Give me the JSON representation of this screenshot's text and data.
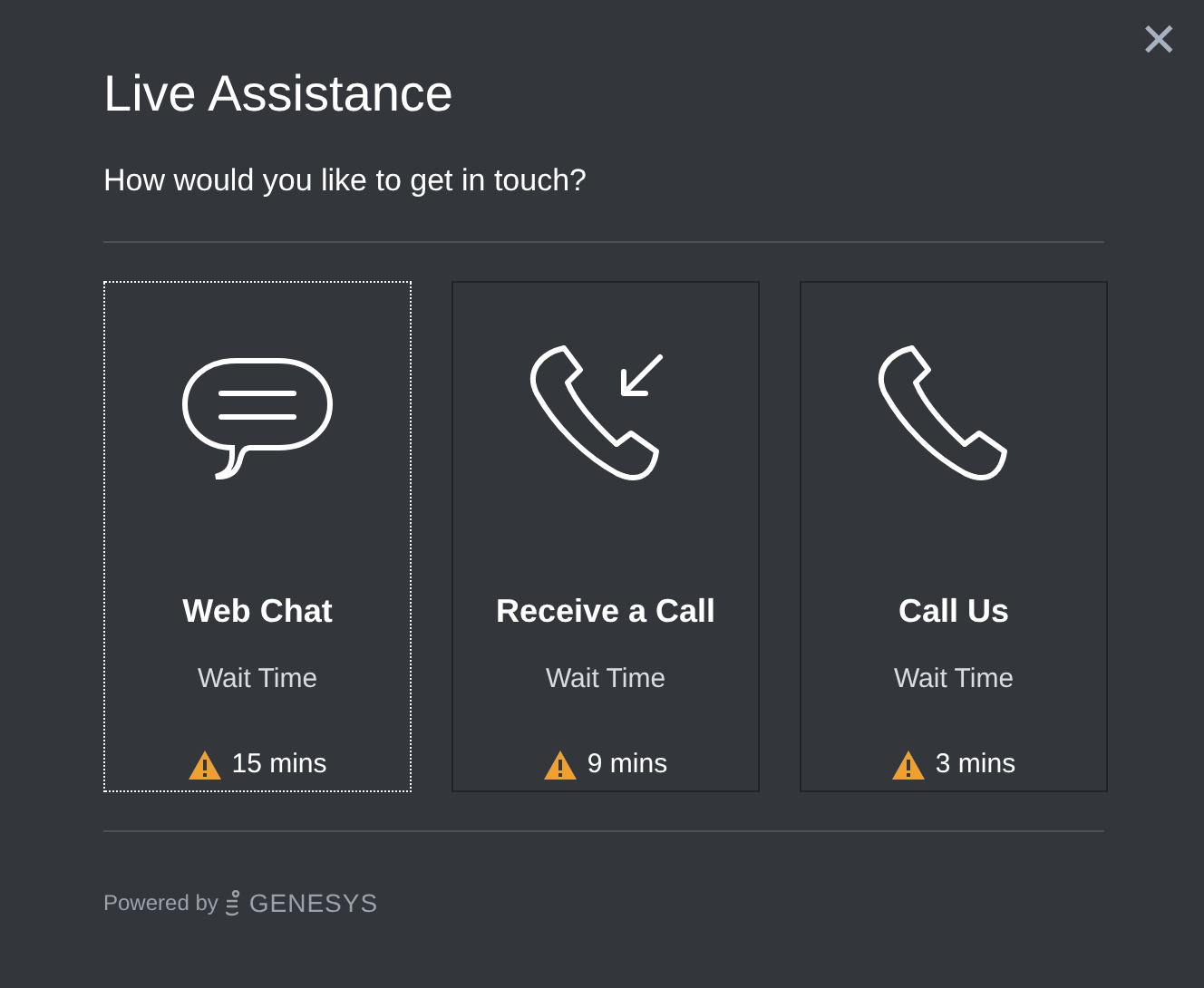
{
  "close": {
    "label": "✕"
  },
  "title": "Live Assistance",
  "question": "How would you like to get in touch?",
  "options": [
    {
      "kind": "chat",
      "label": "Web Chat",
      "wait_label": "Wait Time",
      "wait": "15 mins",
      "selected": true
    },
    {
      "kind": "callback",
      "label": "Receive a Call",
      "wait_label": "Wait Time",
      "wait": "9 mins",
      "selected": false
    },
    {
      "kind": "call",
      "label": "Call Us",
      "wait_label": "Wait Time",
      "wait": "3 mins",
      "selected": false
    }
  ],
  "footer": {
    "powered_by": "Powered by",
    "brand": "GENESYS"
  }
}
